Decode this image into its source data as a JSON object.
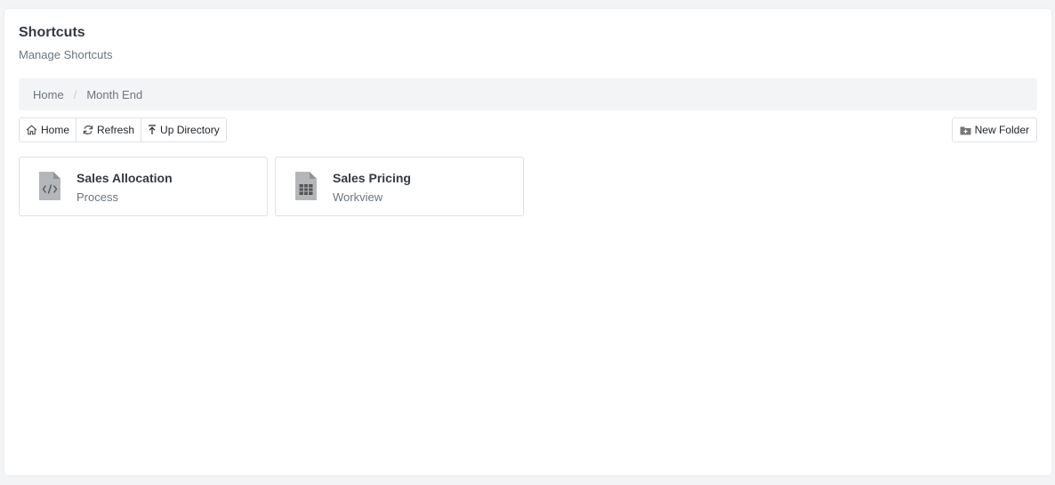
{
  "header": {
    "title": "Shortcuts",
    "subtitle": "Manage Shortcuts"
  },
  "breadcrumb": {
    "items": [
      "Home",
      "Month End"
    ],
    "separator": "/"
  },
  "toolbar": {
    "home_label": "Home",
    "refresh_label": "Refresh",
    "up_label": "Up Directory",
    "new_folder_label": "New Folder",
    "icons": [
      "home-icon",
      "refresh-icon",
      "up-arrow-icon",
      "folder-plus-icon"
    ]
  },
  "shortcuts": [
    {
      "name": "Sales Allocation",
      "type": "Process",
      "icon": "code-file-icon"
    },
    {
      "name": "Sales Pricing",
      "type": "Workview",
      "icon": "table-file-icon"
    }
  ],
  "colors": {
    "icon_gray": "#8a8f94",
    "muted_text": "#6c757d",
    "border": "#dee2e6",
    "breadcrumb_bg": "#f3f4f6"
  }
}
